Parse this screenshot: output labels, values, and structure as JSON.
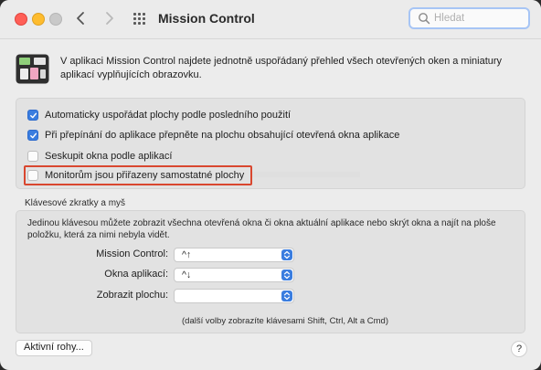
{
  "window": {
    "title": "Mission Control",
    "search_placeholder": "Hledat"
  },
  "intro": {
    "text": "V aplikaci Mission Control najdete jednotně uspořádaný přehled všech otevřených oken a miniatury aplikací vyplňujících obrazovku."
  },
  "options": [
    {
      "label": "Automaticky uspořádat plochy podle posledního použití",
      "checked": true
    },
    {
      "label": "Při přepínání do aplikace přepněte na plochu obsahující otevřená okna aplikace",
      "checked": true
    },
    {
      "label": "Seskupit okna podle aplikací",
      "checked": false
    },
    {
      "label": "Monitorům jsou přiřazeny samostatné plochy",
      "checked": false
    }
  ],
  "shortcuts": {
    "section_label": "Klávesové zkratky a myš",
    "description": "Jedinou klávesou můžete zobrazit všechna otevřená okna či okna aktuální aplikace nebo skrýt okna a najít na ploše položku, která za nimi nebyla vidět.",
    "rows": [
      {
        "label": "Mission Control:",
        "value": "^↑"
      },
      {
        "label": "Okna aplikací:",
        "value": "^↓"
      },
      {
        "label": "Zobrazit plochu:",
        "value": ""
      }
    ],
    "modifiers_note": "(další volby zobrazíte klávesami Shift, Ctrl, Alt a Cmd)"
  },
  "footer": {
    "hot_corners_label": "Aktivní rohy...",
    "help_label": "?"
  },
  "colors": {
    "accent": "#3a7ddf",
    "highlight_border": "#d9472f"
  }
}
